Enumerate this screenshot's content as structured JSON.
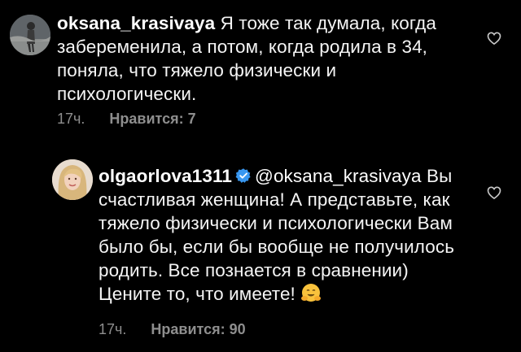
{
  "comments": [
    {
      "username": "oksana_krasivaya",
      "verified": false,
      "mention": "",
      "text": "Я тоже так думала, когда забеременила, а потом, когда родила в 34, поняла, что тяжело физически и психологически.",
      "time": "17ч.",
      "likes": "Нравится: 7",
      "avatar_icon": "user-avatar",
      "like_icon": "heart-outline-icon"
    },
    {
      "username": "olgaorlova1311",
      "verified": true,
      "mention": "@oksana_krasivaya",
      "text": "Вы счастливая женщина! А представьте, как тяжело физически и психологически Вам было бы, если бы вообще не получилось родить. Все познается в сравнении) Цените то, что имеете!",
      "emoji_icon": "hugging-face-emoji",
      "time": "17ч.",
      "likes": "Нравится: 90",
      "avatar_icon": "user-avatar",
      "like_icon": "heart-outline-icon"
    }
  ],
  "colors": {
    "background": "#000000",
    "text": "#f5f5f5",
    "meta": "#8e8e8e",
    "verified_badge": "#3897f0"
  }
}
